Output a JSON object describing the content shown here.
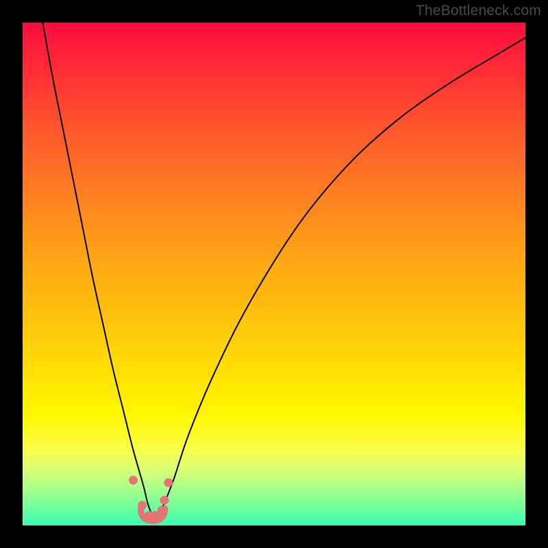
{
  "watermark": "TheBottleneck.com",
  "chart_data": {
    "type": "line",
    "title": "",
    "xlabel": "",
    "ylabel": "",
    "xlim": [
      0,
      100
    ],
    "ylim": [
      0,
      100
    ],
    "grid": false,
    "series": [
      {
        "name": "bottleneck-curve",
        "x": [
          4,
          6,
          8,
          10,
          12,
          14,
          16,
          18,
          20,
          22,
          24,
          25,
          26,
          27,
          28,
          30,
          33,
          38,
          45,
          55,
          65,
          75,
          85,
          95,
          100
        ],
        "y": [
          100,
          89,
          79,
          69,
          59,
          49,
          40,
          31,
          23,
          15,
          8,
          4,
          2,
          2,
          4,
          9,
          18,
          30,
          44,
          60,
          72,
          81,
          88,
          94,
          97
        ]
      }
    ],
    "markers": {
      "name": "trough-dots",
      "x": [
        22.0,
        23.8,
        25.2,
        26.4,
        27.7,
        28.2,
        29.0
      ],
      "y": [
        9.0,
        4.0,
        2.0,
        2.0,
        3.0,
        5.0,
        8.5
      ]
    },
    "trough_arc": {
      "x_start": 23.5,
      "x_end": 28.3,
      "y": 2.0
    },
    "colors": {
      "curve": "#000000",
      "dots": "#e27575",
      "gradient_top": "#ff0b3f",
      "gradient_bottom": "#38ffb0"
    }
  }
}
